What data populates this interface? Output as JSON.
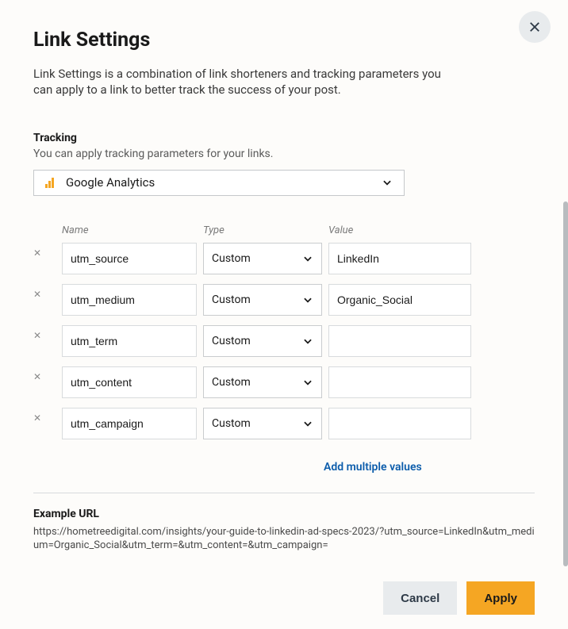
{
  "title": "Link Settings",
  "description": "Link Settings is a combination of link shorteners and tracking parameters you can apply to a link to better track the success of your post.",
  "tracking": {
    "label": "Tracking",
    "sublabel": "You can apply tracking parameters for your links.",
    "selected": "Google Analytics"
  },
  "columns": {
    "name": "Name",
    "type": "Type",
    "value": "Value"
  },
  "params": [
    {
      "name": "utm_source",
      "type": "Custom",
      "value": "LinkedIn"
    },
    {
      "name": "utm_medium",
      "type": "Custom",
      "value": "Organic_Social"
    },
    {
      "name": "utm_term",
      "type": "Custom",
      "value": ""
    },
    {
      "name": "utm_content",
      "type": "Custom",
      "value": ""
    },
    {
      "name": "utm_campaign",
      "type": "Custom",
      "value": ""
    }
  ],
  "add_multiple": "Add multiple values",
  "example": {
    "label": "Example URL",
    "url": "https://hometreedigital.com/insights/your-guide-to-linkedin-ad-specs-2023/?utm_source=LinkedIn&utm_medium=Organic_Social&utm_term=&utm_content=&utm_campaign="
  },
  "buttons": {
    "cancel": "Cancel",
    "apply": "Apply"
  }
}
